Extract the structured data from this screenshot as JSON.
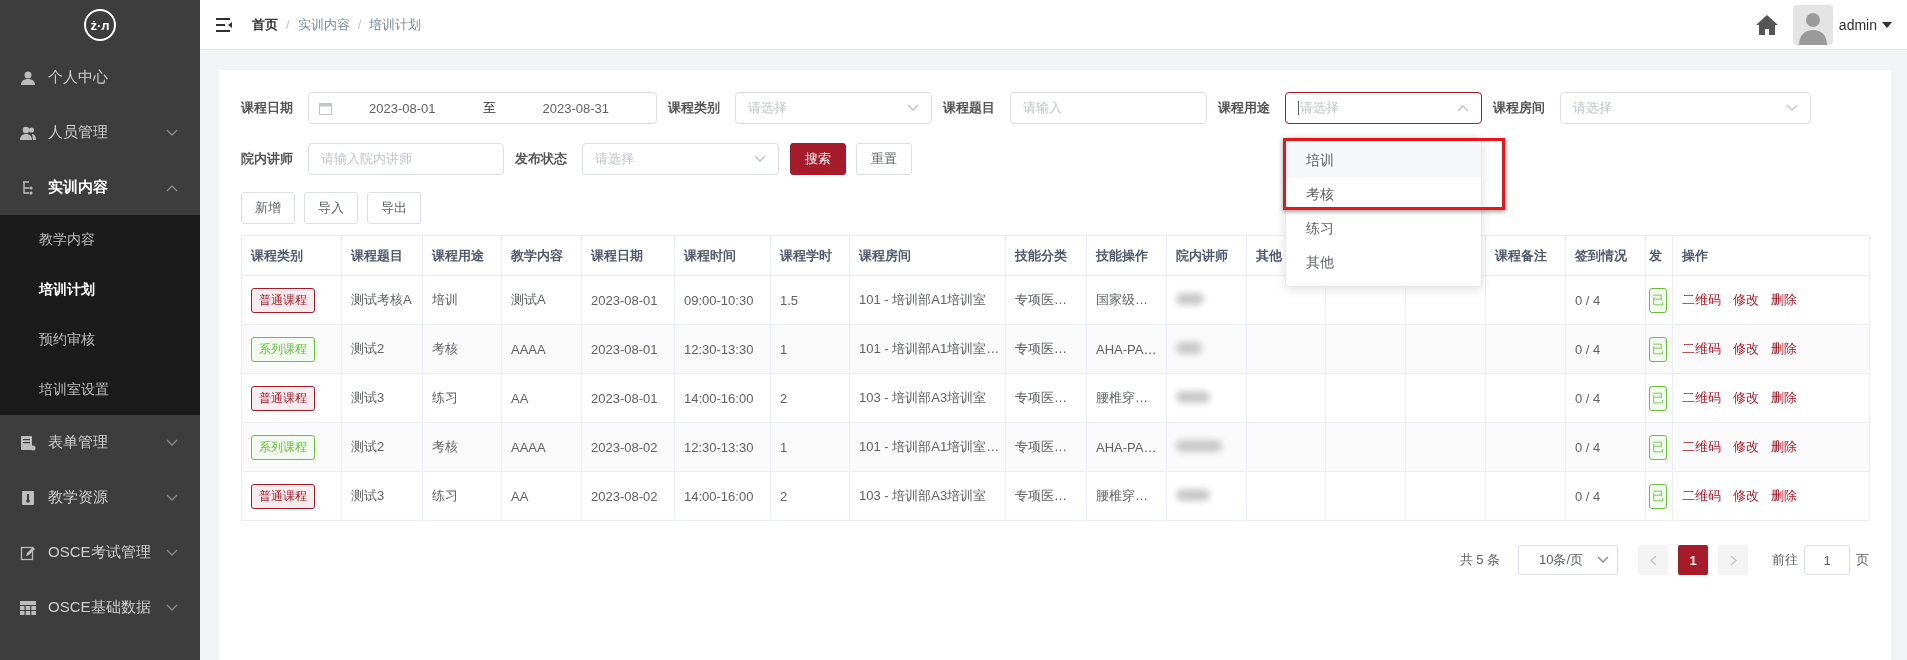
{
  "logo": "ż·л",
  "sidebar": {
    "items": [
      {
        "label": "个人中心"
      },
      {
        "label": "人员管理",
        "expanded": false
      },
      {
        "label": "实训内容",
        "expanded": true,
        "children": [
          {
            "label": "教学内容",
            "selected": false
          },
          {
            "label": "培训计划",
            "selected": true
          },
          {
            "label": "预约审核",
            "selected": false
          },
          {
            "label": "培训室设置",
            "selected": false
          }
        ]
      },
      {
        "label": "表单管理",
        "expanded": false
      },
      {
        "label": "教学资源",
        "expanded": false
      },
      {
        "label": "OSCE考试管理",
        "expanded": false
      },
      {
        "label": "OSCE基础数据",
        "expanded": false
      }
    ]
  },
  "header": {
    "breadcrumb": [
      "首页",
      "实训内容",
      "培训计划"
    ],
    "separator": "/",
    "user": "admin"
  },
  "filters": {
    "items": [
      {
        "kind": "daterange",
        "label": "课程日期",
        "start": "2023-08-01",
        "separator": "至",
        "end": "2023-08-31"
      },
      {
        "kind": "select",
        "label": "课程类别",
        "placeholder": "请选择",
        "open": false
      },
      {
        "kind": "input",
        "label": "课程题目",
        "placeholder": "请输入"
      },
      {
        "kind": "select",
        "label": "课程用途",
        "placeholder": "请选择",
        "open": true,
        "options": [
          {
            "label": "培训",
            "highlighted": true
          },
          {
            "label": "考核",
            "highlighted": false
          },
          {
            "label": "练习",
            "highlighted": false
          },
          {
            "label": "其他",
            "highlighted": false
          }
        ]
      },
      {
        "kind": "select",
        "label": "课程房间",
        "placeholder": "请选择",
        "open": false
      },
      {
        "kind": "input",
        "label": "院内讲师",
        "placeholder": "请输入院内讲师"
      },
      {
        "kind": "select",
        "label": "发布状态",
        "placeholder": "请选择",
        "open": false
      },
      {
        "kind": "button",
        "label": "搜索",
        "primary": true
      },
      {
        "kind": "button",
        "label": "重置",
        "primary": false
      }
    ]
  },
  "toolbar": [
    "新增",
    "导入",
    "导出"
  ],
  "table": {
    "columns": [
      "课程类别",
      "课程题目",
      "课程用途",
      "教学内容",
      "课程日期",
      "课程时间",
      "课程学时",
      "课程房间",
      "技能分类",
      "技能操作",
      "院内讲师",
      "其他",
      null,
      null,
      "课程备注",
      "签到情况",
      "发"
    ],
    "action_column": "操作",
    "rows": [
      {
        "cells": [
          {
            "text": "普通课程",
            "color": "#a61b29"
          },
          "测试考核A",
          "培训",
          "测试A",
          "2023-08-01",
          "09:00-10:30",
          "1.5",
          "101 - 培训部A1培训室",
          "专项医…",
          "国家级…",
          null,
          null,
          null,
          null,
          null,
          "0 / 4",
          {
            "text": "已",
            "color": "#67c23a"
          }
        ],
        "actions": [
          "二维码",
          "修改",
          "删除"
        ]
      },
      {
        "cells": [
          {
            "text": "系列课程",
            "color": "#67c23a"
          },
          "测试2",
          "考核",
          "AAAA",
          "2023-08-01",
          "12:30-13:30",
          "1",
          "101 - 培训部A1培训室…",
          "专项医…",
          "AHA-PA…",
          null,
          null,
          null,
          null,
          null,
          "0 / 4",
          {
            "text": "已",
            "color": "#67c23a"
          }
        ],
        "actions": [
          "二维码",
          "修改",
          "删除"
        ]
      },
      {
        "cells": [
          {
            "text": "普通课程",
            "color": "#a61b29"
          },
          "测试3",
          "练习",
          "AA",
          "2023-08-01",
          "14:00-16:00",
          "2",
          "103 - 培训部A3培训室",
          "专项医…",
          "腰椎穿…",
          null,
          null,
          null,
          null,
          null,
          "0 / 4",
          {
            "text": "已",
            "color": "#67c23a"
          }
        ],
        "actions": [
          "二维码",
          "修改",
          "删除"
        ]
      },
      {
        "cells": [
          {
            "text": "系列课程",
            "color": "#67c23a"
          },
          "测试2",
          "考核",
          "AAAA",
          "2023-08-02",
          "12:30-13:30",
          "1",
          "101 - 培训部A1培训室…",
          "专项医…",
          "AHA-PA…",
          null,
          null,
          null,
          null,
          null,
          "0 / 4",
          {
            "text": "已",
            "color": "#67c23a"
          }
        ],
        "actions": [
          "二维码",
          "修改",
          "删除"
        ]
      },
      {
        "cells": [
          {
            "text": "普通课程",
            "color": "#a61b29"
          },
          "测试3",
          "练习",
          "AA",
          "2023-08-02",
          "14:00-16:00",
          "2",
          "103 - 培训部A3培训室",
          "专项医…",
          "腰椎穿…",
          null,
          null,
          null,
          null,
          null,
          "0 / 4",
          {
            "text": "已",
            "color": "#67c23a"
          }
        ],
        "actions": [
          "二维码",
          "修改",
          "删除"
        ]
      }
    ]
  },
  "pagination": {
    "total": "共 5 条",
    "page_size": "10条/页",
    "pages": [
      {
        "label": "1",
        "selected": true
      }
    ],
    "goto_label": "前往",
    "goto_value": "1",
    "goto_suffix": "页"
  }
}
